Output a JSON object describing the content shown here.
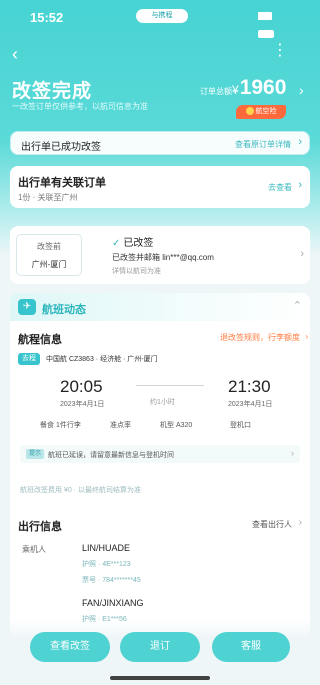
{
  "status": {
    "time": "15:52",
    "island": "与携程"
  },
  "header": {
    "title": "改签完成",
    "subtitle": "一改签订单仅供参考，以航司信息为准",
    "price_label": "订单总额",
    "currency": "¥",
    "price": "1960",
    "tag": "航空险"
  },
  "order_row": {
    "label": "出行单已成功改签",
    "action": "查看原订单详情"
  },
  "assoc": {
    "title": "出行单有关联订单",
    "detail": "1份 · 关联至广州",
    "action": "去查看"
  },
  "change": {
    "box_top": "改签前",
    "box_bottom": "广州-厦门",
    "contact": "已改签",
    "line2": "已改签并邮箱 lin***@qq.com",
    "line3": "详情以航司为准"
  },
  "flight": {
    "header_title": "航班动态",
    "section_title": "航程信息",
    "section_action": "退改签规则，行李额度",
    "dep_tag": "去程",
    "dep_info": "中国航 CZ3863 · 经济舱 · 广州-厦门",
    "dep_time": "20:05",
    "arr_time": "21:30",
    "dep_date": "2023年4月1日",
    "arr_date": "2023年4月1日",
    "duration": "约1小时",
    "features": [
      "餐食 1件行李",
      "准点率",
      "机型 A320",
      "登机口"
    ],
    "note_tag": "提示",
    "note": "航班已延误，请留意最新信息与登机时间",
    "footnote": "航班改签费用 ¥0 · 以最终航司结算为准"
  },
  "trip": {
    "section_title": "出行信息",
    "section_action": "查看出行人",
    "passenger_label": "乘机人",
    "p1_name": "LIN/HUADE",
    "p1_a": "护照 · 4E***123",
    "p1_b": "票号 · 784*******45",
    "p2_name": "FAN/JINXIANG",
    "p2_a": "护照 · E1***56"
  },
  "buttons": {
    "b1": "查看改签",
    "b2": "退订",
    "b3": "客服"
  }
}
